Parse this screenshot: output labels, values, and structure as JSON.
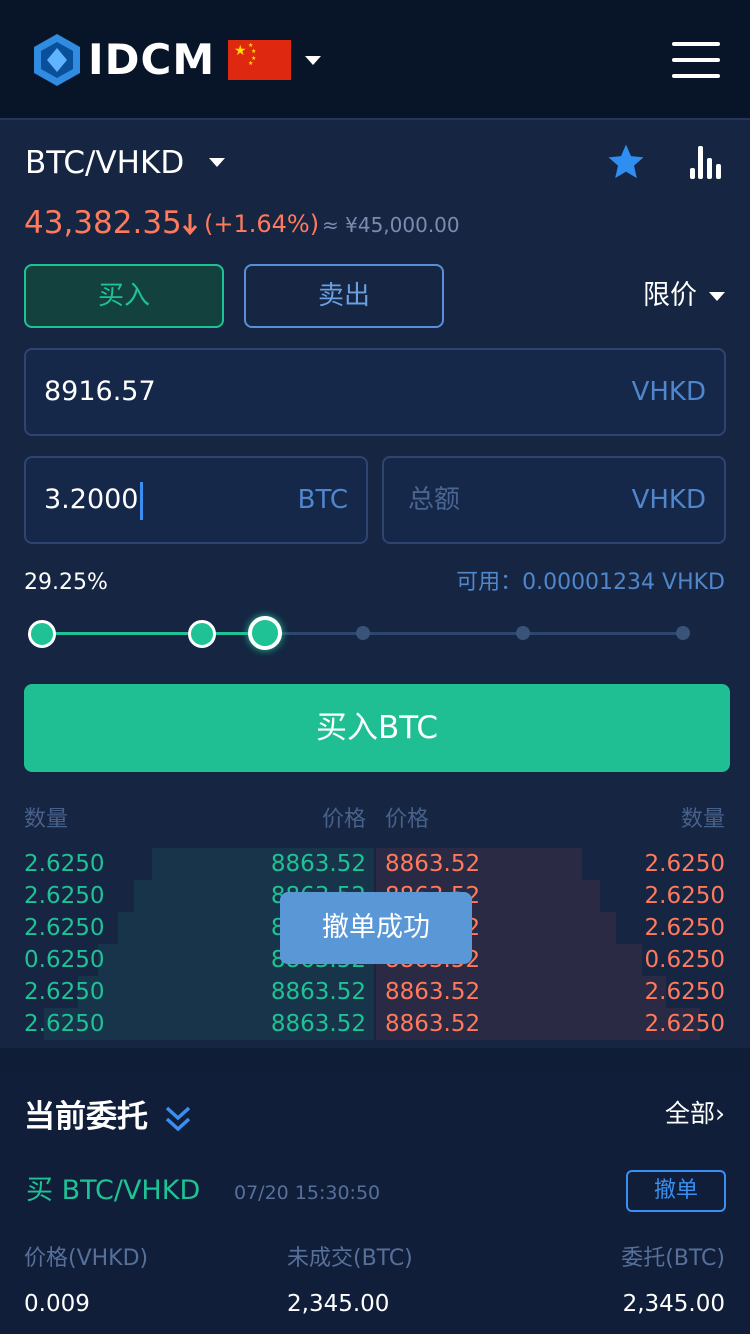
{
  "header": {
    "brand": "IDCM",
    "logo_icon": "idcm-logo-icon",
    "flag_icon": "china-flag-icon",
    "menu_icon": "hamburger-menu-icon"
  },
  "market": {
    "pair": "BTC/VHKD",
    "price": "43,382.35",
    "change": "(+1.64%)",
    "approx": "≈ ¥45,000.00",
    "favorite_icon": "star-icon",
    "chart_icon": "bar-chart-icon"
  },
  "trade": {
    "buy_tab": "买入",
    "sell_tab": "卖出",
    "order_type": "限价",
    "price_value": "8916.57",
    "price_unit": "VHKD",
    "amount_value": "3.2000",
    "amount_unit": "BTC",
    "total_placeholder": "总额",
    "total_unit": "VHKD",
    "percent": "29.25%",
    "available": "可用：0.00001234 VHKD",
    "slider_level": 0.2925,
    "buy_button": "买入BTC"
  },
  "orderbook": {
    "headers": {
      "bid_qty": "数量",
      "bid_price": "价格",
      "ask_price": "价格",
      "ask_qty": "数量"
    },
    "rows": [
      {
        "bid_qty": "2.6250",
        "bid_price": "8863.52",
        "ask_price": "8863.52",
        "ask_qty": "2.6250"
      },
      {
        "bid_qty": "2.6250",
        "bid_price": "8863.52",
        "ask_price": "8863.52",
        "ask_qty": "2.6250"
      },
      {
        "bid_qty": "2.6250",
        "bid_price": "8863.52",
        "ask_price": "8863.52",
        "ask_qty": "2.6250"
      },
      {
        "bid_qty": "0.6250",
        "bid_price": "8863.52",
        "ask_price": "8863.52",
        "ask_qty": "0.6250"
      },
      {
        "bid_qty": "2.6250",
        "bid_price": "8863.52",
        "ask_price": "8863.52",
        "ask_qty": "2.6250"
      },
      {
        "bid_qty": "2.6250",
        "bid_price": "8863.52",
        "ask_price": "8863.52",
        "ask_qty": "2.6250"
      }
    ]
  },
  "toast": "撤单成功",
  "orders": {
    "title": "当前委托",
    "all_link": "全部",
    "item": {
      "side_pair": "买 BTC/VHKD",
      "time": "07/20 15:30:50",
      "cancel": "撤单",
      "price_label": "价格(VHKD)",
      "unfilled_label": "未成交(BTC)",
      "order_label": "委托(BTC)",
      "price": "0.009",
      "unfilled": "2,345.00",
      "order": "2,345.00"
    }
  },
  "colors": {
    "background": "#152542",
    "header": "#081428",
    "buy_green": "#1fc295",
    "sell_red": "#ff7a5c",
    "accent_blue": "#3a8ff0"
  }
}
